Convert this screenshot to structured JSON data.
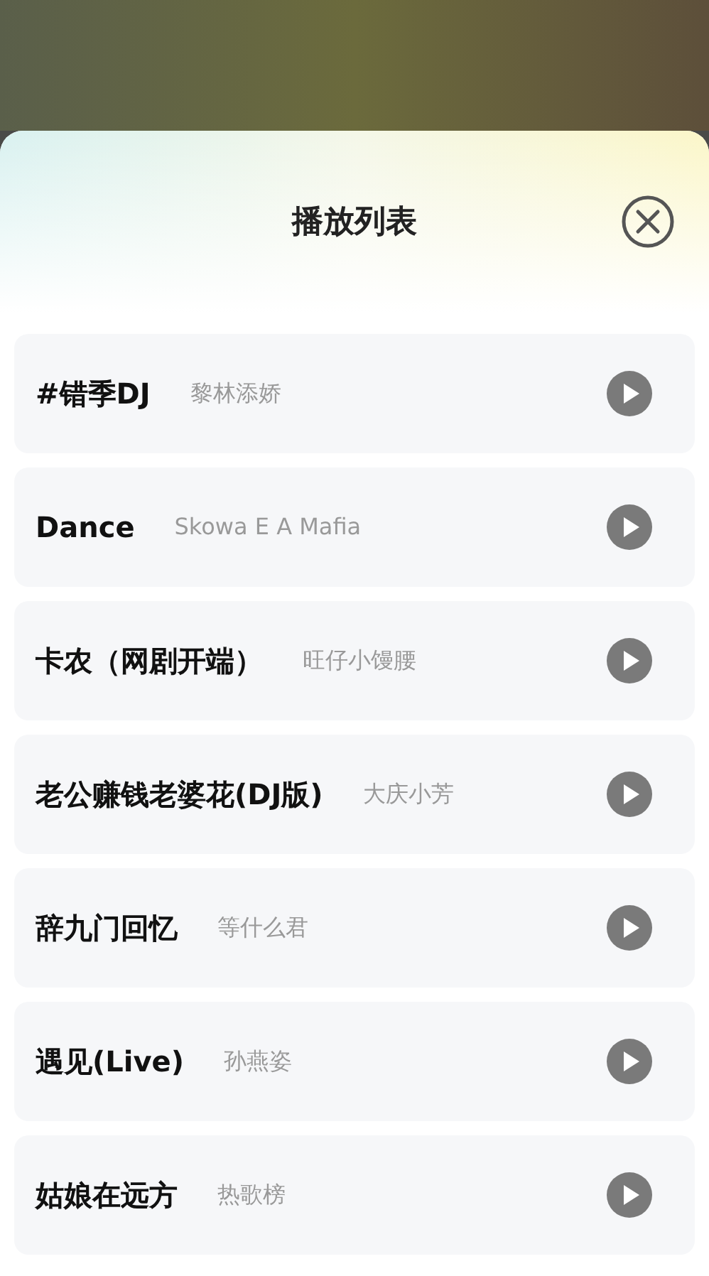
{
  "sheet": {
    "title": "播放列表"
  },
  "songs": [
    {
      "title": "#错季DJ",
      "artist": "黎林添娇"
    },
    {
      "title": "Dance",
      "artist": "Skowa E A Mafia"
    },
    {
      "title": "卡农（网剧开端）",
      "artist": "旺仔小馒腰"
    },
    {
      "title": "老公赚钱老婆花(DJ版)",
      "artist": "大庆小芳"
    },
    {
      "title": "辞九门回忆",
      "artist": "等什么君"
    },
    {
      "title": "遇见(Live)",
      "artist": "孙燕姿"
    },
    {
      "title": "姑娘在远方",
      "artist": "热歌榜"
    }
  ]
}
